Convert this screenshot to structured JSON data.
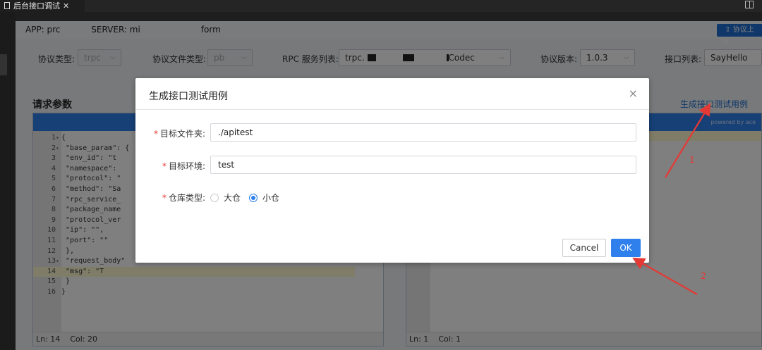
{
  "editor_tab": {
    "title": "后台接口调试",
    "close": "✕"
  },
  "appbar": {
    "app_label": "APP: prc",
    "server_label": "SERVER: mi",
    "server_suffix": "form",
    "upload_label": "协议上传"
  },
  "filters": {
    "proto_type_label": "协议类型:",
    "proto_type_value": "trpc",
    "proto_file_label": "协议文件类型:",
    "proto_file_value": "pb",
    "rpc_label": "RPC 服务列表:",
    "rpc_value_prefix": "trpc.",
    "rpc_value_suffix": "Codec",
    "version_label": "协议版本:",
    "version_value": "1.0.3",
    "api_label": "接口列表:",
    "api_value": "SayHello"
  },
  "section": {
    "title": "请求参数",
    "generate_link": "生成接口测试用例"
  },
  "left_editor": {
    "powered": "",
    "lines": [
      {
        "n": "1",
        "fold": "▾",
        "text": "{"
      },
      {
        "n": "2",
        "fold": "▾",
        "text": "  \"base_param\": {"
      },
      {
        "n": "3",
        "fold": "",
        "text": "    \"env_id\": \"t"
      },
      {
        "n": "4",
        "fold": "",
        "text": "    \"namespace\":"
      },
      {
        "n": "5",
        "fold": "",
        "text": "    \"protocol\": \""
      },
      {
        "n": "6",
        "fold": "",
        "text": "    \"method\": \"Sa"
      },
      {
        "n": "7",
        "fold": "",
        "text": "    \"rpc_service_"
      },
      {
        "n": "8",
        "fold": "",
        "text": "    \"package_name"
      },
      {
        "n": "9",
        "fold": "",
        "text": "    \"protocol_ver"
      },
      {
        "n": "10",
        "fold": "",
        "text": "    \"ip\": \"\","
      },
      {
        "n": "11",
        "fold": "",
        "text": "    \"port\": \"\""
      },
      {
        "n": "12",
        "fold": "",
        "text": "  },"
      },
      {
        "n": "13",
        "fold": "▾",
        "text": "  \"request_body\""
      },
      {
        "n": "14",
        "fold": "",
        "text": "    \"msg\": \"T"
      },
      {
        "n": "15",
        "fold": "",
        "text": "  }"
      },
      {
        "n": "16",
        "fold": "",
        "text": "}"
      }
    ],
    "status_ln": "Ln: 14",
    "status_col": "Col: 20"
  },
  "right_editor": {
    "powered": "powered by ace",
    "status_ln": "Ln: 1",
    "status_col": "Col: 1"
  },
  "modal": {
    "title": "生成接口测试用例",
    "close": "×",
    "target_dir_label": "目标文件夹:",
    "target_dir_value": "./apitest",
    "target_env_label": "目标环境:",
    "target_env_value": "test",
    "repo_type_label": "仓库类型:",
    "repo_options": [
      "大仓",
      "小仓"
    ],
    "repo_selected": "小仓",
    "required_mark": "*",
    "cancel_label": "Cancel",
    "ok_label": "OK"
  },
  "annotations": {
    "one": "1",
    "two": "2",
    "color": "#e53935"
  },
  "colors": {
    "primary": "#2f80ed",
    "link": "#1f6fd2",
    "required": "#e53935"
  }
}
